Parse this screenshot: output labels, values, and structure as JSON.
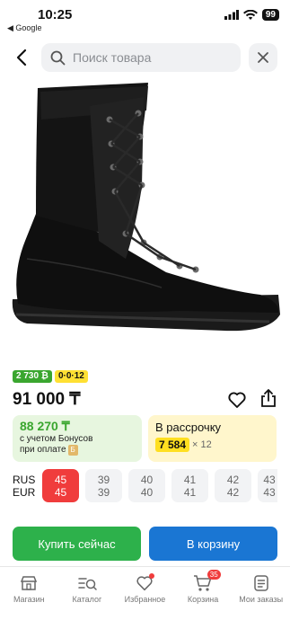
{
  "status_bar": {
    "time": "10:25",
    "back_app": "◀ Google",
    "battery": "99"
  },
  "search": {
    "placeholder": "Поиск товара"
  },
  "badges": {
    "bonus": "2 730 ₿",
    "installment": "0·0·12"
  },
  "product": {
    "price": "91 000 ₸"
  },
  "offers": {
    "bonus_amount": "88 270 ₸",
    "bonus_note_line1": "с учетом Бонусов",
    "bonus_note_line2": "при оплате",
    "bonus_icon": "Б",
    "installment_title": "В рассрочку",
    "installment_amount": "7 584",
    "installment_months": "× 12"
  },
  "sizes": {
    "label_rus": "RUS",
    "label_eur": "EUR",
    "items": [
      {
        "rus": "45",
        "eur": "45",
        "selected": true
      },
      {
        "rus": "39",
        "eur": "39",
        "selected": false
      },
      {
        "rus": "40",
        "eur": "40",
        "selected": false
      },
      {
        "rus": "41",
        "eur": "41",
        "selected": false
      },
      {
        "rus": "42",
        "eur": "42",
        "selected": false
      },
      {
        "rus": "43",
        "eur": "43",
        "selected": false
      }
    ]
  },
  "actions": {
    "buy_now": "Купить сейчас",
    "add_to_cart": "В корзину"
  },
  "nav": {
    "items": [
      {
        "label": "Магазин",
        "icon": "shop-icon"
      },
      {
        "label": "Каталог",
        "icon": "catalog-search-icon"
      },
      {
        "label": "Избранное",
        "icon": "heart-icon"
      },
      {
        "label": "Корзина",
        "icon": "cart-icon"
      },
      {
        "label": "Мои заказы",
        "icon": "orders-icon"
      }
    ],
    "cart_count": "35"
  },
  "colors": {
    "accent_green": "#2db14b",
    "accent_blue": "#1a76d3",
    "selected_red": "#f03c3c"
  }
}
